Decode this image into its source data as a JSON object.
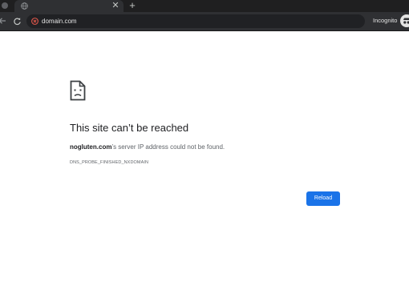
{
  "tabstrip": {
    "tab": {
      "favicon": "globe-icon",
      "close_label": "✕"
    },
    "new_tab_label": "+"
  },
  "toolbar": {
    "back_icon": "arrow-back-icon",
    "reload_icon_glyph": "C",
    "url": "domain.com",
    "site_info_icon": "error-icon",
    "incognito_label": "Incognito",
    "incognito_icon": "incognito-icon"
  },
  "error": {
    "icon": "sad-page-icon",
    "title": "This site can’t be reached",
    "host": "nogluten.com",
    "description_rest": "’s server IP address could not be found.",
    "code": "DNS_PROBE_FINISHED_NXDOMAIN",
    "reload_label": "Reload"
  },
  "colors": {
    "tab_strip_bg": "#1f1f20",
    "toolbar_bg": "#2f3033",
    "omnibox_bg": "#202124",
    "site_info_red": "#e3584c",
    "primary_blue": "#1a73e8",
    "title_text": "#202124",
    "body_text": "#5f6368"
  }
}
